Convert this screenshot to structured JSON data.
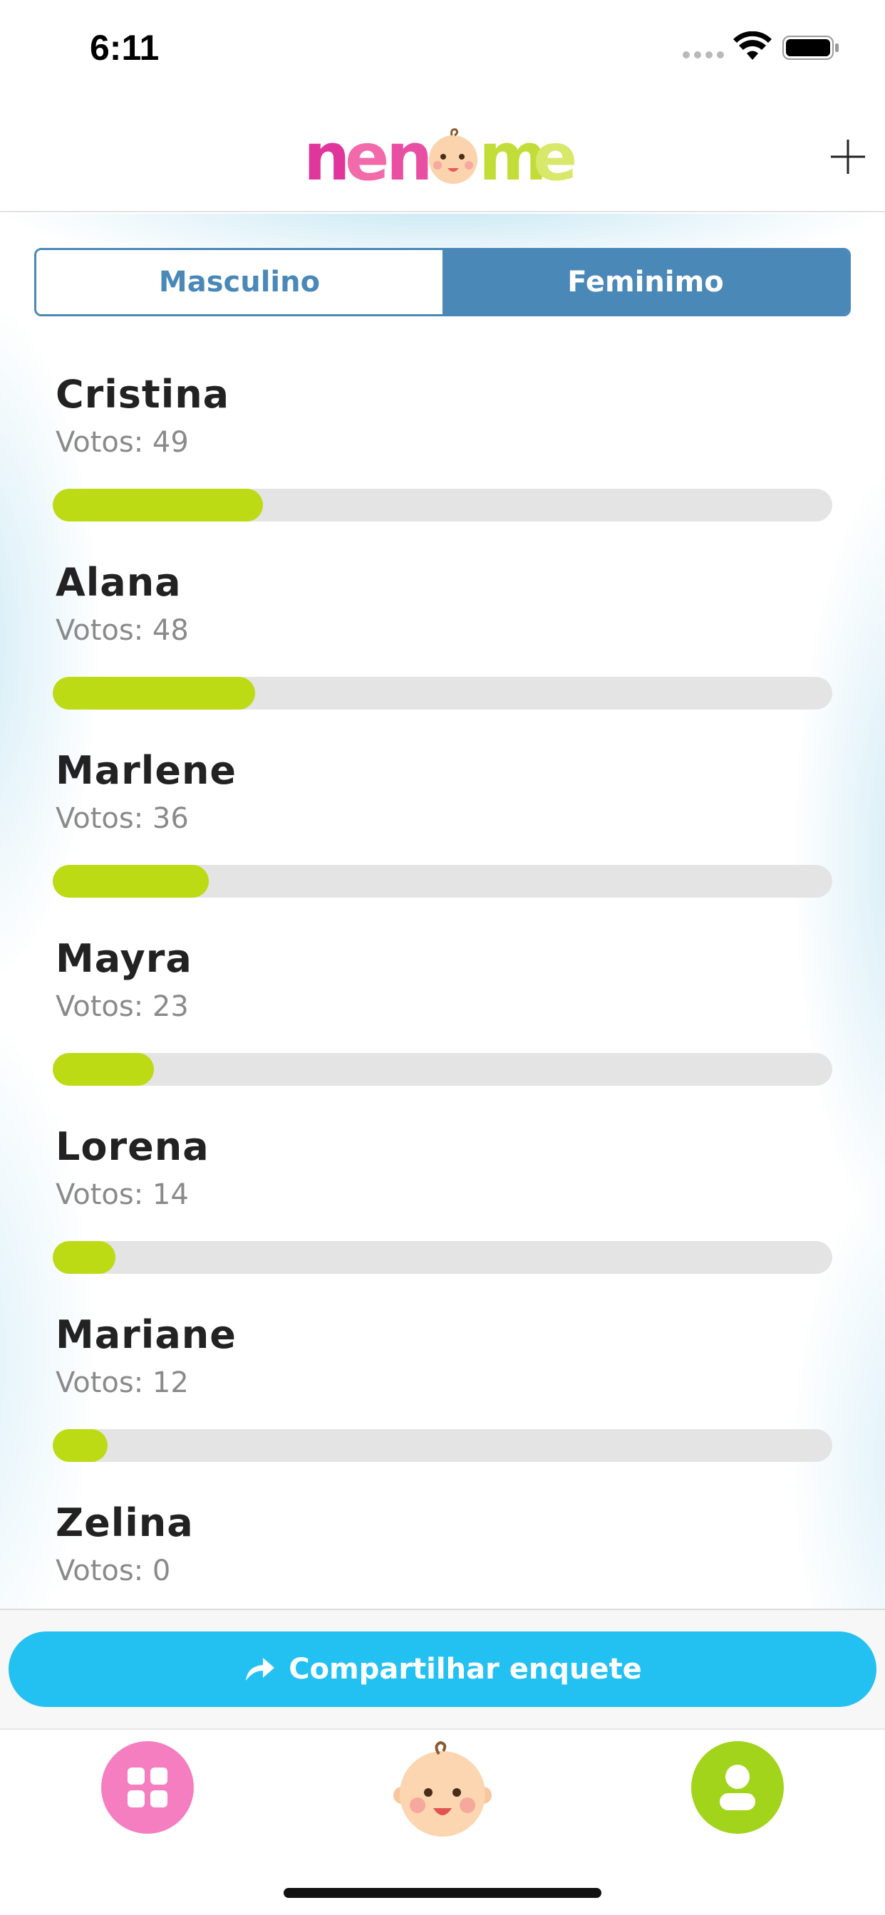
{
  "status_bar": {
    "time": "6:11"
  },
  "header": {
    "logo_text": "nenome"
  },
  "segmented": {
    "male_label": "Masculino",
    "female_label": "Feminimo",
    "selected": "Feminimo"
  },
  "poll": {
    "votes_prefix": "Votos: ",
    "fill_color": "#bcdb14",
    "track_color": "#e4e4e4",
    "items": [
      {
        "name": "Cristina",
        "votes_text": "Votos: 49",
        "votes": 49,
        "bar_fraction": 0.27
      },
      {
        "name": "Alana",
        "votes_text": "Votos: 48",
        "votes": 48,
        "bar_fraction": 0.26
      },
      {
        "name": "Marlene",
        "votes_text": "Votos: 36",
        "votes": 36,
        "bar_fraction": 0.2
      },
      {
        "name": "Mayra",
        "votes_text": "Votos: 23",
        "votes": 23,
        "bar_fraction": 0.13
      },
      {
        "name": "Lorena",
        "votes_text": "Votos: 14",
        "votes": 14,
        "bar_fraction": 0.08
      },
      {
        "name": "Mariane",
        "votes_text": "Votos: 12",
        "votes": 12,
        "bar_fraction": 0.07
      },
      {
        "name": "Zelina",
        "votes_text": "Votos: 0",
        "votes": 0,
        "bar_fraction": null
      }
    ]
  },
  "share": {
    "label": "Compartilhar enquete",
    "color": "#23c1f2"
  },
  "tab_bar": {
    "grid_color": "#f57ec0",
    "profile_color": "#a2d41c",
    "icons": [
      "grid-icon",
      "baby-face-icon",
      "profile-icon"
    ]
  },
  "colors": {
    "accent_blue": "#4a88b8"
  }
}
